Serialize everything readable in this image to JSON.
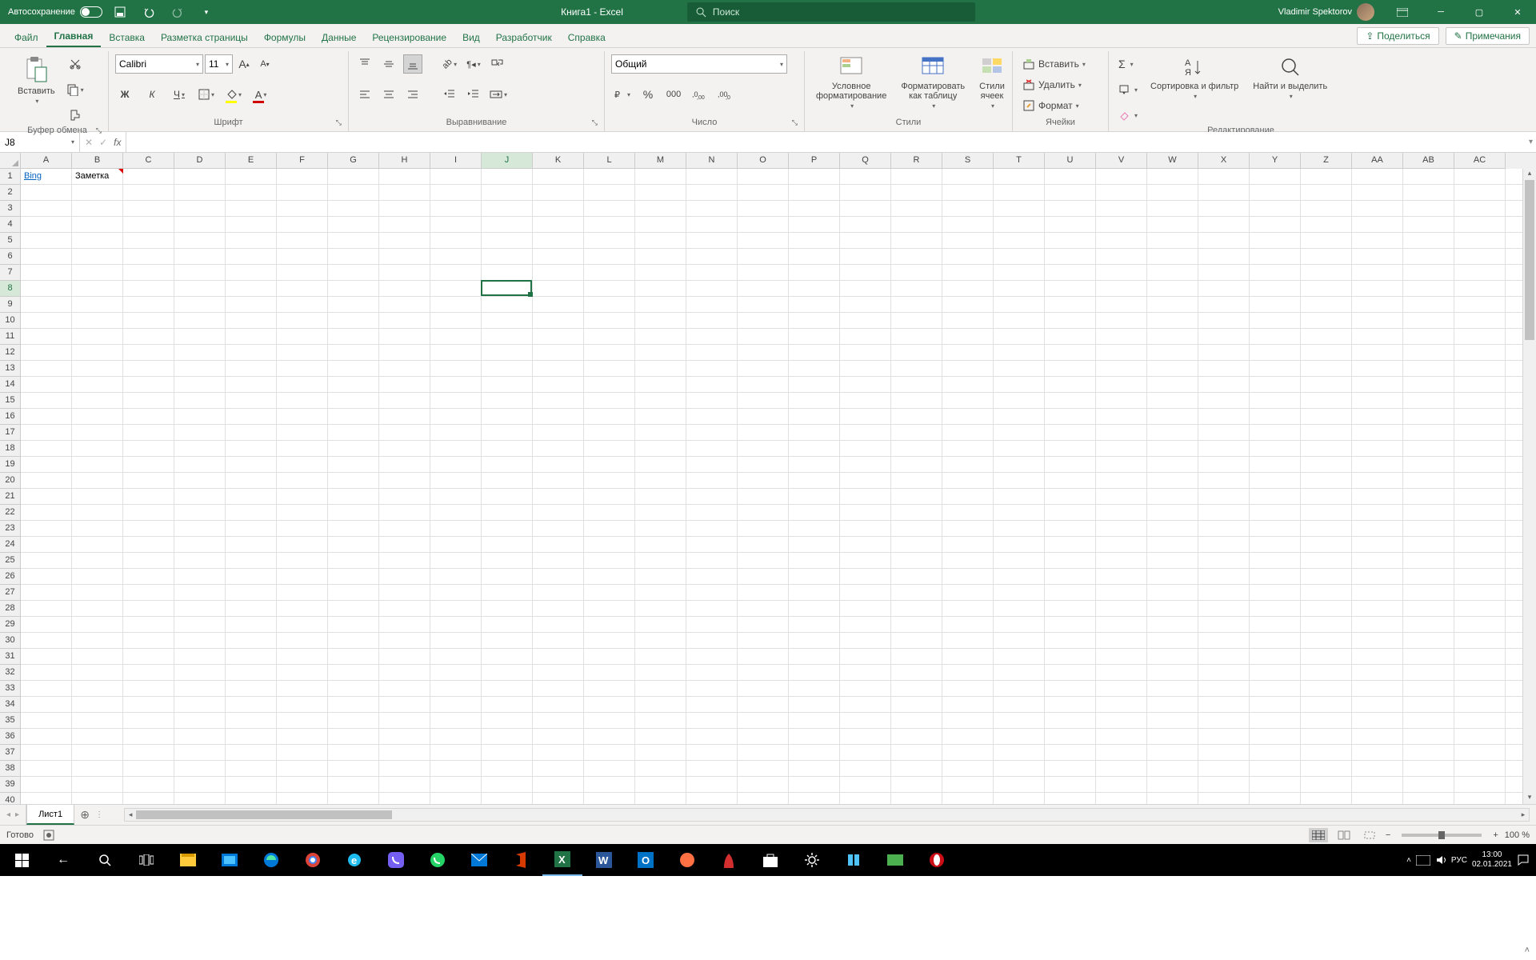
{
  "title": {
    "autosave_label": "Автосохранение",
    "doc_title": "Книга1  -  Excel",
    "search_placeholder": "Поиск",
    "user_name": "Vladimir Spektorov"
  },
  "tabs": {
    "file": "Файл",
    "items": [
      "Главная",
      "Вставка",
      "Разметка страницы",
      "Формулы",
      "Данные",
      "Рецензирование",
      "Вид",
      "Разработчик",
      "Справка"
    ],
    "active_index": 0,
    "share": "Поделиться",
    "comments": "Примечания"
  },
  "ribbon": {
    "clipboard": {
      "label": "Буфер обмена",
      "paste": "Вставить"
    },
    "font": {
      "label": "Шрифт",
      "name": "Calibri",
      "size": "11",
      "bold": "Ж",
      "italic": "К",
      "underline": "Ч"
    },
    "align": {
      "label": "Выравнивание"
    },
    "number": {
      "label": "Число",
      "format": "Общий"
    },
    "styles": {
      "label": "Стили",
      "cond": "Условное форматирование",
      "table": "Форматировать как таблицу",
      "cell": "Стили ячеек"
    },
    "cells": {
      "label": "Ячейки",
      "insert": "Вставить",
      "delete": "Удалить",
      "format": "Формат"
    },
    "editing": {
      "label": "Редактирование",
      "sort": "Сортировка и фильтр",
      "find": "Найти и выделить"
    }
  },
  "name_box": "J8",
  "formula": "",
  "columns": [
    "A",
    "B",
    "C",
    "D",
    "E",
    "F",
    "G",
    "H",
    "I",
    "J",
    "K",
    "L",
    "M",
    "N",
    "O",
    "P",
    "Q",
    "R",
    "S",
    "T",
    "U",
    "V",
    "W",
    "X",
    "Y",
    "Z",
    "AA",
    "AB",
    "AC"
  ],
  "active_col_index": 9,
  "row_count": 42,
  "active_row": 8,
  "cells": {
    "A1": {
      "text": "Bing",
      "link": true
    },
    "B1": {
      "text": "Заметка"
    }
  },
  "comment_at": "B1",
  "sheet_tabs": {
    "active": "Лист1"
  },
  "status": {
    "ready": "Готово",
    "zoom": "100 %"
  },
  "taskbar": {
    "lang": "РУС",
    "time": "13:00",
    "date": "02.01.2021"
  }
}
